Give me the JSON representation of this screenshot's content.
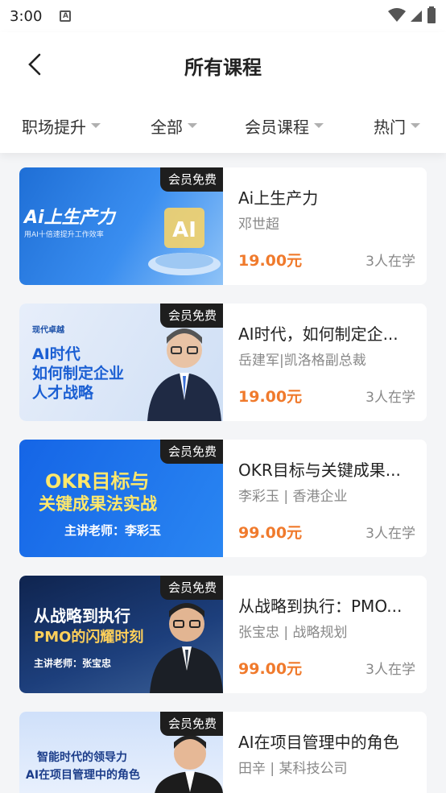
{
  "status": {
    "time": "3:00"
  },
  "header": {
    "title": "所有课程"
  },
  "filters": [
    {
      "label": "职场提升"
    },
    {
      "label": "全部"
    },
    {
      "label": "会员课程"
    },
    {
      "label": "热门"
    }
  ],
  "badge": "会员免费",
  "courses": [
    {
      "title": "Ai上生产力",
      "teacher": "邓世超",
      "price": "19.00元",
      "learners": "3人在学",
      "thumb_line1": "Ai上生产力",
      "thumb_line2": "用AI十倍速提升工作效率",
      "thumb_line3": "",
      "thumb_bg": "#2d7de0"
    },
    {
      "title": "AI时代，如何制定企...",
      "teacher": "岳建军|凯洛格副总裁",
      "price": "19.00元",
      "learners": "3人在学",
      "thumb_line1": "AI时代",
      "thumb_line2": "如何制定企业",
      "thumb_line3": "人才战略",
      "thumb_logo": "现代卓越",
      "thumb_bg": "#dde8f6"
    },
    {
      "title": "OKR目标与关键成果...",
      "teacher": "李彩玉 | 香港企业",
      "price": "99.00元",
      "learners": "3人在学",
      "thumb_line1": "OKR目标与",
      "thumb_line2": "关键成果法实战",
      "thumb_line3": "主讲老师：李彩玉",
      "thumb_bg": "#1a6ee8"
    },
    {
      "title": "从战略到执行：PMO...",
      "teacher": "张宝忠 | 战略规划",
      "price": "99.00元",
      "learners": "3人在学",
      "thumb_line1": "从战略到执行",
      "thumb_line2": "PMO的闪耀时刻",
      "thumb_line3": "主讲老师：张宝忠",
      "thumb_bg": "#16305e"
    },
    {
      "title": "AI在项目管理中的角色",
      "teacher": "田辛 | 某科技公司",
      "price": "",
      "learners": "",
      "thumb_line1": "智能时代的领导力",
      "thumb_line2": "AI在项目管理中的角色",
      "thumb_line3": "",
      "thumb_bg": "#dbe8fb"
    }
  ],
  "colors": {
    "price": "#f07a2c",
    "badge_bg": "#1e1e1e",
    "page_bg": "#f4f5f7"
  }
}
